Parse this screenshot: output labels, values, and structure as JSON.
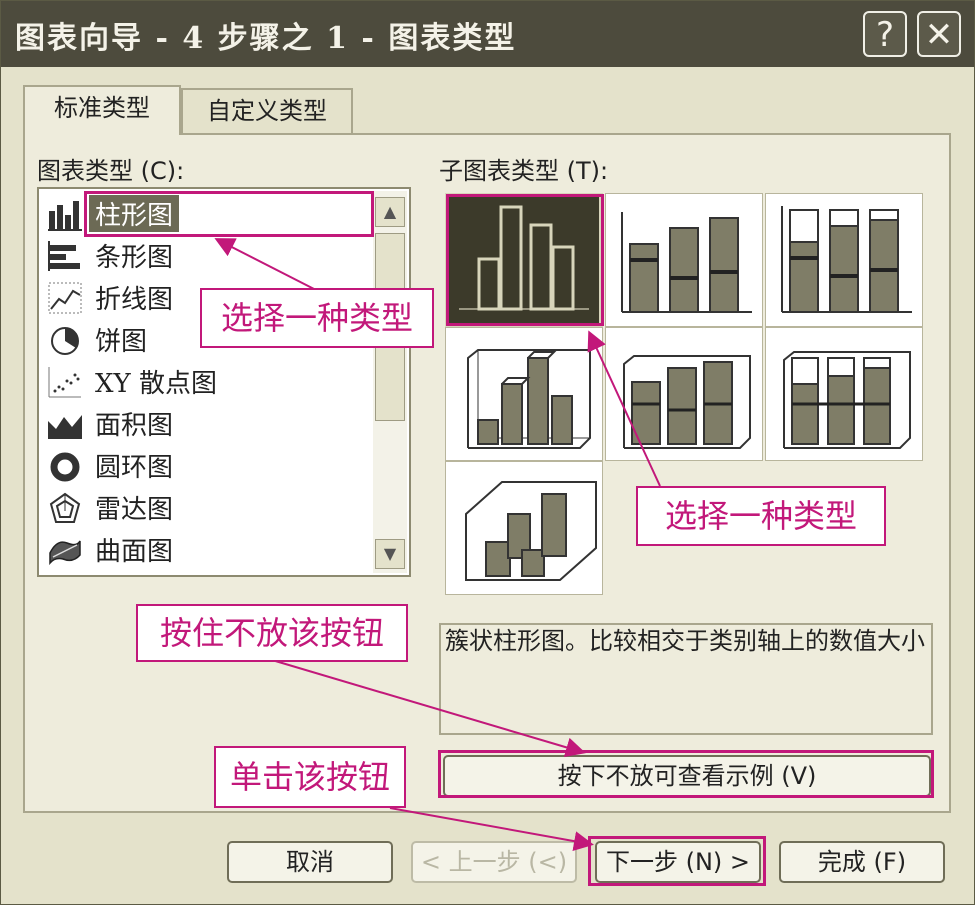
{
  "window": {
    "title": "图表向导 - 4 步骤之 1 - 图表类型",
    "help_button": "?",
    "close_button": "✕"
  },
  "tabs": [
    {
      "label": "标准类型",
      "active": true
    },
    {
      "label": "自定义类型",
      "active": false
    }
  ],
  "chart_type_list": {
    "label": "图表类型 (C):",
    "items": [
      {
        "label": "柱形图",
        "icon": "column-chart-icon",
        "selected": true
      },
      {
        "label": "条形图",
        "icon": "bar-chart-icon",
        "selected": false
      },
      {
        "label": "折线图",
        "icon": "line-chart-icon",
        "selected": false
      },
      {
        "label": "饼图",
        "icon": "pie-chart-icon",
        "selected": false
      },
      {
        "label": "XY 散点图",
        "icon": "scatter-chart-icon",
        "selected": false
      },
      {
        "label": "面积图",
        "icon": "area-chart-icon",
        "selected": false
      },
      {
        "label": "圆环图",
        "icon": "doughnut-chart-icon",
        "selected": false
      },
      {
        "label": "雷达图",
        "icon": "radar-chart-icon",
        "selected": false
      },
      {
        "label": "曲面图",
        "icon": "surface-chart-icon",
        "selected": false
      }
    ]
  },
  "subtype": {
    "label": "子图表类型 (T):",
    "items": [
      {
        "name": "clustered-column-icon",
        "selected": true
      },
      {
        "name": "stacked-column-icon",
        "selected": false
      },
      {
        "name": "percent-stacked-column-icon",
        "selected": false
      },
      {
        "name": "3d-clustered-column-icon",
        "selected": false
      },
      {
        "name": "3d-stacked-column-icon",
        "selected": false
      },
      {
        "name": "3d-percent-stacked-column-icon",
        "selected": false
      },
      {
        "name": "3d-column-icon",
        "selected": false
      }
    ],
    "description": "簇状柱形图。比较相交于类别轴上的数值大小"
  },
  "buttons": {
    "preview": "按下不放可查看示例 (V)",
    "cancel": "取消",
    "back": "< 上一步 (<)",
    "next": "下一步 (N) >",
    "finish": "完成 (F)"
  },
  "annotations": {
    "select_type_1": "选择一种类型",
    "select_type_2": "选择一种类型",
    "hold_button": "按住不放该按钮",
    "click_button": "单击该按钮"
  },
  "colors": {
    "highlight": "#c2187a",
    "title_bar": "#4d4b3d",
    "dialog_bg": "#e4e2cb"
  }
}
